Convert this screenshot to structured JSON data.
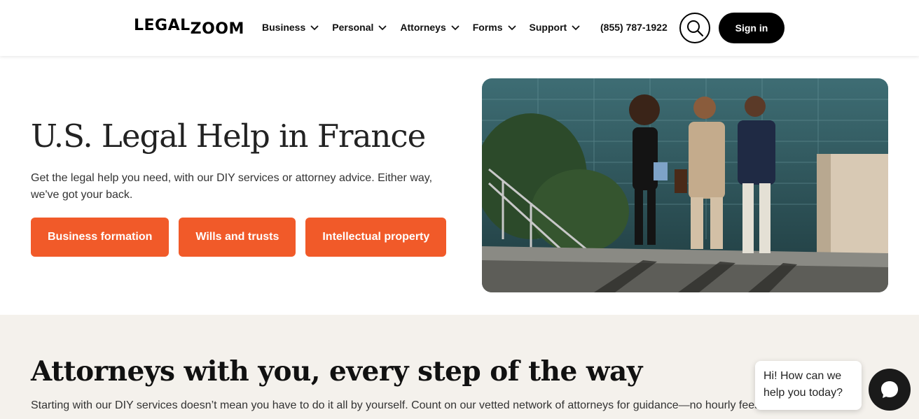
{
  "header": {
    "logo_top": "LEGAL",
    "logo_bottom": "ZOOM",
    "nav": [
      {
        "label": "Business"
      },
      {
        "label": "Personal"
      },
      {
        "label": "Attorneys"
      },
      {
        "label": "Forms"
      },
      {
        "label": "Support"
      }
    ],
    "phone": "(855) 787-1922",
    "signin_label": "Sign in"
  },
  "hero": {
    "title": "U.S. Legal Help in France",
    "subtitle": "Get the legal help you need, with our DIY services or attorney advice. Either way, we've got your back.",
    "ctas": [
      {
        "label": "Business formation"
      },
      {
        "label": "Wills and trusts"
      },
      {
        "label": "Intellectual property"
      }
    ],
    "image_icon": "business-people-photo"
  },
  "section2": {
    "title": "Attorneys with you, every step of the way",
    "text": "Starting with our DIY services doesn’t mean you have to do it all by yourself. Count on our vetted network of attorneys for guidance—no hourly fees on advice visits."
  },
  "chat": {
    "bubble_text": "Hi! How can we help you today?"
  },
  "colors": {
    "accent": "#f15a29",
    "dark": "#000000",
    "section_bg": "#f4f1ec"
  }
}
